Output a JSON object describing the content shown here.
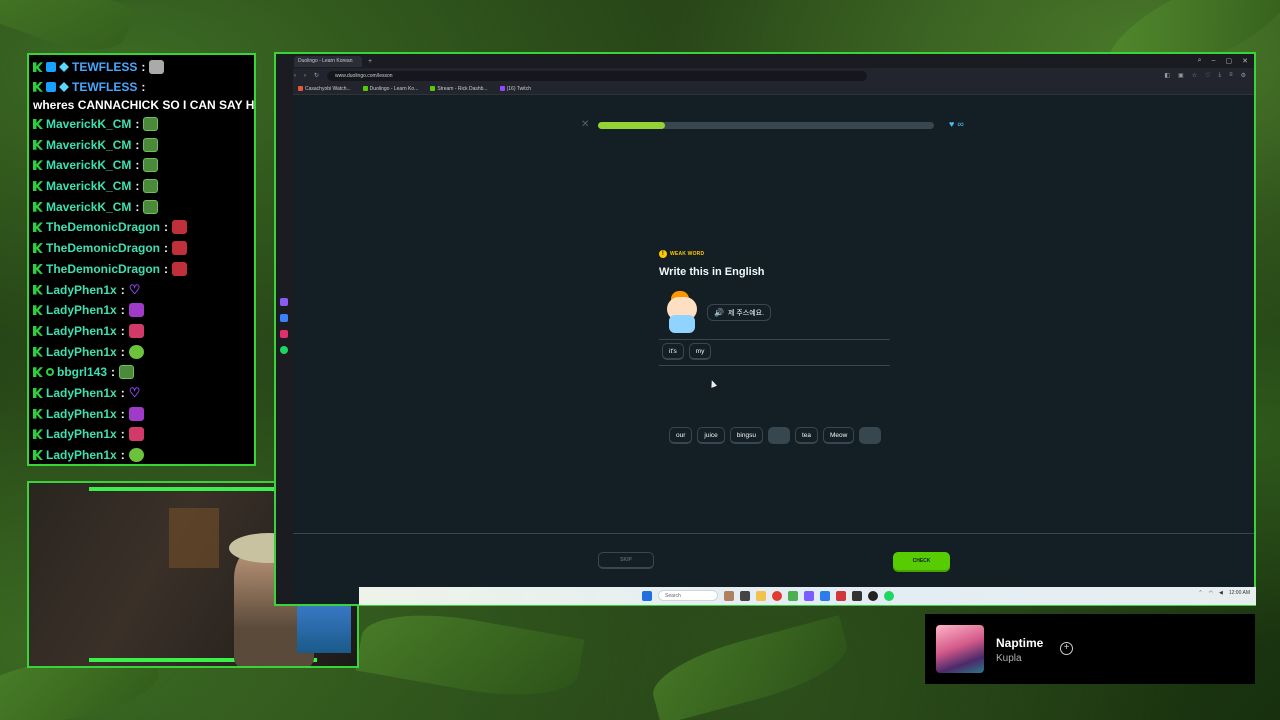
{
  "chat": {
    "messages": [
      {
        "user": "TEWFLESS",
        "text": "",
        "emote": "grey",
        "color": "blue",
        "badges": [
          "k",
          "p",
          "d"
        ]
      },
      {
        "user": "TEWFLESS",
        "text": "wheres CANNACHICK SO I CAN SAY HI",
        "emote": "",
        "color": "blue",
        "badges": [
          "k",
          "p",
          "d"
        ]
      },
      {
        "user": "MaverickK_CM",
        "text": "",
        "emote": "lurk",
        "color": "teal",
        "badges": [
          "k"
        ]
      },
      {
        "user": "MaverickK_CM",
        "text": "",
        "emote": "lurk",
        "color": "teal",
        "badges": [
          "k"
        ]
      },
      {
        "user": "MaverickK_CM",
        "text": "",
        "emote": "lurk",
        "color": "teal",
        "badges": [
          "k"
        ]
      },
      {
        "user": "MaverickK_CM",
        "text": "",
        "emote": "lurk",
        "color": "teal",
        "badges": [
          "k"
        ]
      },
      {
        "user": "MaverickK_CM",
        "text": "",
        "emote": "lurk",
        "color": "teal",
        "badges": [
          "k"
        ]
      },
      {
        "user": "TheDemonicDragon",
        "text": "",
        "emote": "red",
        "color": "teal",
        "badges": [
          "k"
        ]
      },
      {
        "user": "TheDemonicDragon",
        "text": "",
        "emote": "red",
        "color": "teal",
        "badges": [
          "k"
        ]
      },
      {
        "user": "TheDemonicDragon",
        "text": "",
        "emote": "red",
        "color": "teal",
        "badges": [
          "k"
        ]
      },
      {
        "user": "LadyPhen1x",
        "text": "",
        "emote": "heart",
        "color": "teal",
        "badges": [
          "k"
        ]
      },
      {
        "user": "LadyPhen1x",
        "text": "",
        "emote": "pixel",
        "color": "teal",
        "badges": [
          "k"
        ]
      },
      {
        "user": "LadyPhen1x",
        "text": "",
        "emote": "pink",
        "color": "teal",
        "badges": [
          "k"
        ]
      },
      {
        "user": "LadyPhen1x",
        "text": "",
        "emote": "green",
        "color": "teal",
        "badges": [
          "k"
        ]
      },
      {
        "user": "bbgrl143",
        "text": "",
        "emote": "lurk",
        "color": "teal",
        "badges": [
          "k",
          "o"
        ]
      },
      {
        "user": "LadyPhen1x",
        "text": "",
        "emote": "heart",
        "color": "teal",
        "badges": [
          "k"
        ]
      },
      {
        "user": "LadyPhen1x",
        "text": "",
        "emote": "pixel",
        "color": "teal",
        "badges": [
          "k"
        ]
      },
      {
        "user": "LadyPhen1x",
        "text": "",
        "emote": "pink",
        "color": "teal",
        "badges": [
          "k"
        ]
      },
      {
        "user": "LadyPhen1x",
        "text": "",
        "emote": "green",
        "color": "teal",
        "badges": [
          "k"
        ]
      }
    ]
  },
  "browser": {
    "tab_title": "Duolingo - Learn Korean",
    "url": "www.duolingo.com/lesson",
    "bookmarks": [
      "Casachyobi Watch...",
      "Duolingo - Learn Ko...",
      "Stream - Rick Dashb...",
      "(16) Twitch"
    ]
  },
  "lesson": {
    "progress": 0.2,
    "hearts": "∞",
    "weak_word_label": "WEAK WORD",
    "heading": "Write this in English",
    "prompt_korean": "제 주스예요.",
    "answer_tiles": [
      "it's",
      "my"
    ],
    "bank_tiles": [
      {
        "label": "our",
        "used": false
      },
      {
        "label": "juice",
        "used": false
      },
      {
        "label": "bingsu",
        "used": false
      },
      {
        "label": "",
        "used": true
      },
      {
        "label": "tea",
        "used": false
      },
      {
        "label": "Meow",
        "used": false
      },
      {
        "label": "",
        "used": true
      }
    ],
    "skip_label": "SKIP",
    "check_label": "CHECK"
  },
  "taskbar": {
    "search_placeholder": "Search",
    "time": "12:00 AM"
  },
  "now_playing": {
    "title": "Naptime",
    "artist": "Kupla"
  },
  "colors": {
    "accent_green": "#39d43a",
    "duo_green": "#58cc02",
    "progress_green": "#93d333",
    "duo_bg": "#131f24"
  }
}
